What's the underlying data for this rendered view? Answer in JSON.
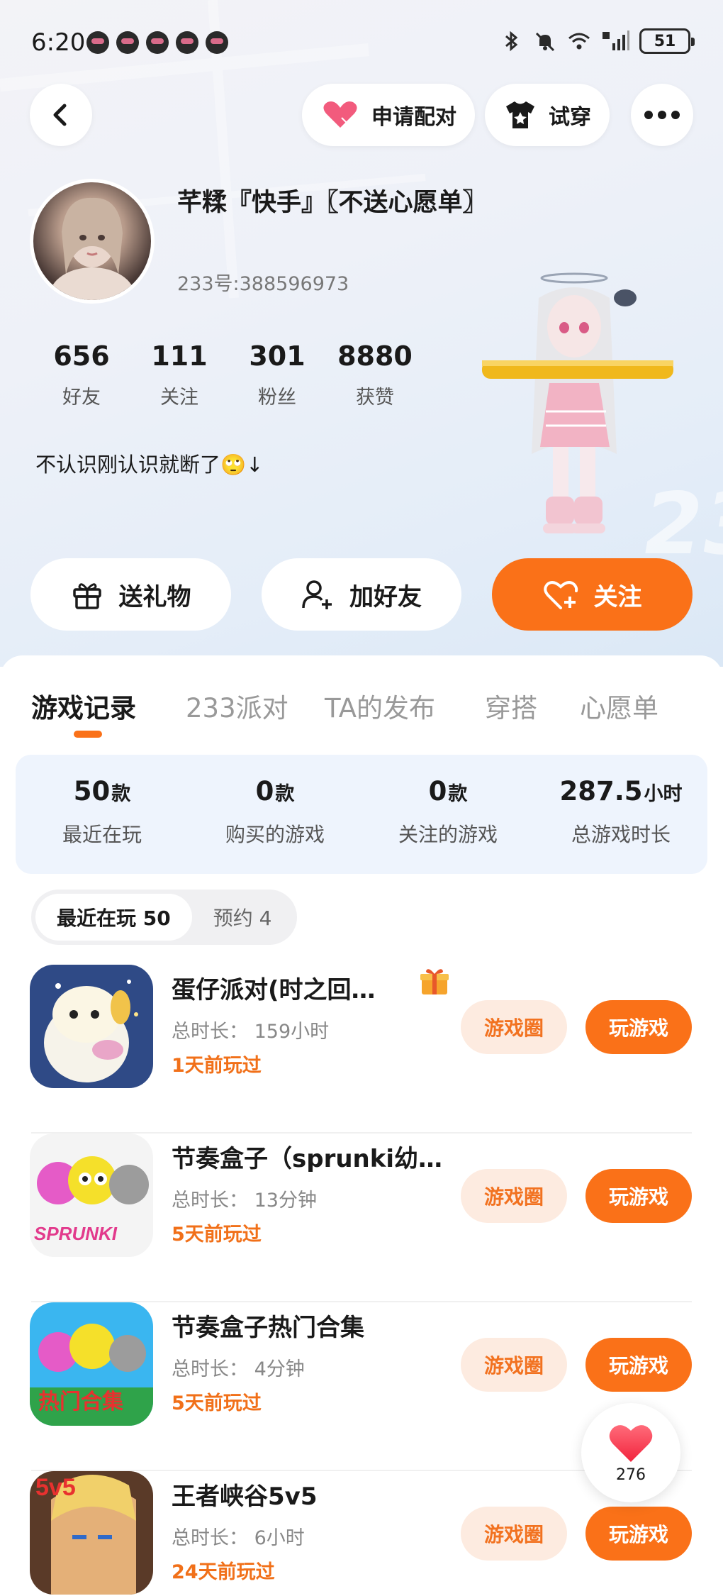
{
  "status_bar": {
    "time": "6:20",
    "battery": "51"
  },
  "top_actions": {
    "pair_label": "申请配对",
    "tryon_label": "试穿"
  },
  "profile": {
    "nickname": "芊糅『快手』〖不送心愿单〗",
    "uid": "233号:388596973",
    "bio": "不认识刚认识就断了🙄↓",
    "stats": [
      {
        "value": "656",
        "label": "好友"
      },
      {
        "value": "111",
        "label": "关注"
      },
      {
        "value": "301",
        "label": "粉丝"
      },
      {
        "value": "8880",
        "label": "获赞"
      }
    ]
  },
  "actions": {
    "gift": "送礼物",
    "add_friend": "加好友",
    "follow": "关注"
  },
  "tabs": [
    "游戏记录",
    "233派对",
    "TA的发布",
    "穿搭",
    "心愿单"
  ],
  "summary": [
    {
      "value": "50",
      "unit": "款",
      "label": "最近在玩"
    },
    {
      "value": "0",
      "unit": "款",
      "label": "购买的游戏"
    },
    {
      "value": "0",
      "unit": "款",
      "label": "关注的游戏"
    },
    {
      "value": "287.5",
      "unit": "小时",
      "label": "总游戏时长"
    }
  ],
  "segments": {
    "recent": "最近在玩 50",
    "reserve": "预约 4"
  },
  "games": [
    {
      "title": "蛋仔派对(时之回…",
      "duration": "总时长： 159小时",
      "last_played": "1天前玩过",
      "circle": "游戏圈",
      "play": "玩游戏"
    },
    {
      "title": "节奏盒子（sprunki幼…",
      "duration": "总时长： 13分钟",
      "last_played": "5天前玩过",
      "circle": "游戏圈",
      "play": "玩游戏"
    },
    {
      "title": "节奏盒子热门合集",
      "duration": "总时长： 4分钟",
      "last_played": "5天前玩过",
      "circle": "游戏圈",
      "play": "玩游戏"
    },
    {
      "title": "王者峡谷5v5",
      "duration": "总时长： 6小时",
      "last_played": "24天前玩过",
      "circle": "游戏圈",
      "play": "玩游戏"
    }
  ],
  "icon_texts": {
    "sprunki": "SPRUNKI",
    "hot_collection": "热门合集",
    "v5": "5v5"
  },
  "like_count": "276",
  "colors": {
    "accent": "#fa7118",
    "accent_light": "#fdebe0",
    "summary_bg": "#eef4fd"
  }
}
